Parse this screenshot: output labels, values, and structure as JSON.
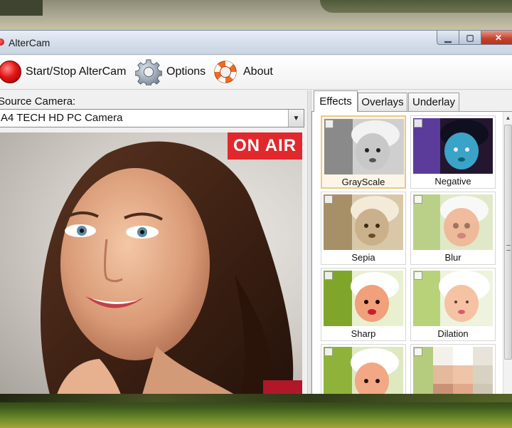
{
  "window": {
    "title": "AlterCam",
    "controls": {
      "minimize": "▁",
      "maximize": "▢",
      "close": "✕"
    }
  },
  "toolbar": {
    "items": [
      {
        "label": "Start/Stop AlterCam",
        "icon": "record-icon"
      },
      {
        "label": "Options",
        "icon": "gear-icon"
      },
      {
        "label": "About",
        "icon": "lifebuoy-icon"
      }
    ]
  },
  "source": {
    "label": "Source Camera:",
    "selected": "A4 TECH HD PC Camera",
    "dropdown_glyph": "▼"
  },
  "preview": {
    "badge": "ON AIR",
    "badge_color": "#e0282d"
  },
  "tabs": [
    {
      "label": "Effects",
      "active": true
    },
    {
      "label": "Overlays",
      "active": false
    },
    {
      "label": "Underlay",
      "active": false
    }
  ],
  "effects": [
    {
      "name": "GrayScale",
      "selected": true
    },
    {
      "name": "Negative",
      "selected": false
    },
    {
      "name": "Sepia",
      "selected": false
    },
    {
      "name": "Blur",
      "selected": false
    },
    {
      "name": "Sharp",
      "selected": false
    },
    {
      "name": "Dilation",
      "selected": false
    },
    {
      "name": "",
      "selected": false
    },
    {
      "name": "",
      "selected": false
    }
  ],
  "scrollbar": {
    "up_glyph": "▲"
  }
}
